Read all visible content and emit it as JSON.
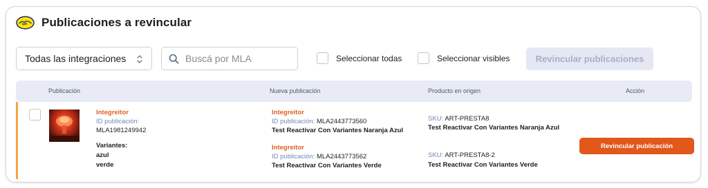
{
  "header": {
    "title": "Publicaciones a revincular"
  },
  "filters": {
    "integration_select": "Todas las integraciones",
    "search_placeholder": "Buscá por MLA",
    "select_all_label": "Seleccionar todas",
    "select_visible_label": "Seleccionar visibles",
    "relink_button": "Revincular publicaciones"
  },
  "table": {
    "columns": [
      "Publicación",
      "Nueva publicación",
      "Producto en origen",
      "Acción"
    ],
    "rows": [
      {
        "publication": {
          "integration": "Integreitor",
          "id_label": "ID publicación:",
          "id": "MLA1981249942",
          "variants_label": "Variantes:",
          "variants": [
            "azul",
            "verde"
          ]
        },
        "new_publications": [
          {
            "integration": "Integreitor",
            "id_label": "ID publicación:",
            "id": "MLA2443773560",
            "title": "Test Reactivar Con Variantes Naranja Azul"
          },
          {
            "integration": "Integreitor",
            "id_label": "ID publicación:",
            "id": "MLA2443773562",
            "title": "Test Reactivar Con Variantes Verde"
          }
        ],
        "origin_products": [
          {
            "sku_label": "SKU:",
            "sku": "ART-PRESTA8",
            "title": "Test Reactivar Con Variantes Naranja Azul"
          },
          {
            "sku_label": "SKU:",
            "sku": "ART-PRESTA8-2",
            "title": "Test Reactivar Con Variantes Verde"
          }
        ],
        "action_label": "Revincular publicación"
      }
    ]
  },
  "colors": {
    "accent": "#e2571c",
    "integration_text": "#e15f23",
    "muted_blue": "#6f88b6",
    "row_marker": "#f7a23c",
    "table_header_bg": "#e8ebf5"
  },
  "icons": {
    "logo": "handshake-logo-icon",
    "select_chevron": "chevron-up-down-icon",
    "search": "search-icon",
    "thumbnail": "product-thumbnail"
  }
}
